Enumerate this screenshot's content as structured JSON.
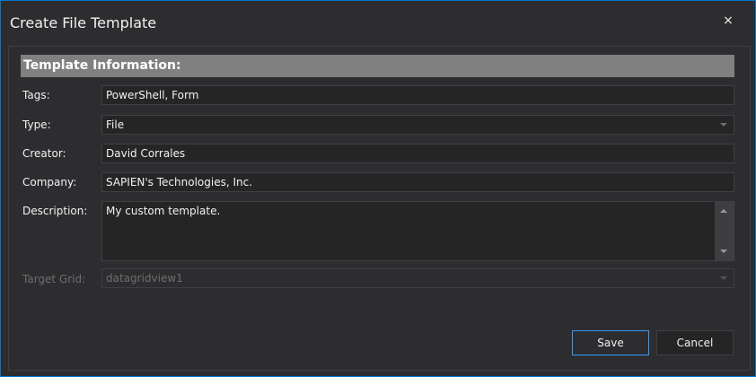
{
  "window": {
    "title": "Create File Template",
    "close": "×"
  },
  "section": {
    "title": "Template Information:"
  },
  "fields": {
    "tags": {
      "label": "Tags:",
      "value": "PowerShell, Form"
    },
    "type": {
      "label": "Type:",
      "value": "File"
    },
    "creator": {
      "label": "Creator:",
      "value": "David Corrales"
    },
    "company": {
      "label": "Company:",
      "value": "SAPIEN's Technologies, Inc."
    },
    "description": {
      "label": "Description:",
      "value": "My custom template."
    },
    "target_grid": {
      "label": "Target Grid:",
      "value": "datagridview1"
    }
  },
  "buttons": {
    "save": "Save",
    "cancel": "Cancel"
  },
  "colors": {
    "accent": "#007acc",
    "background": "#2d2d30",
    "header": "#808080"
  }
}
